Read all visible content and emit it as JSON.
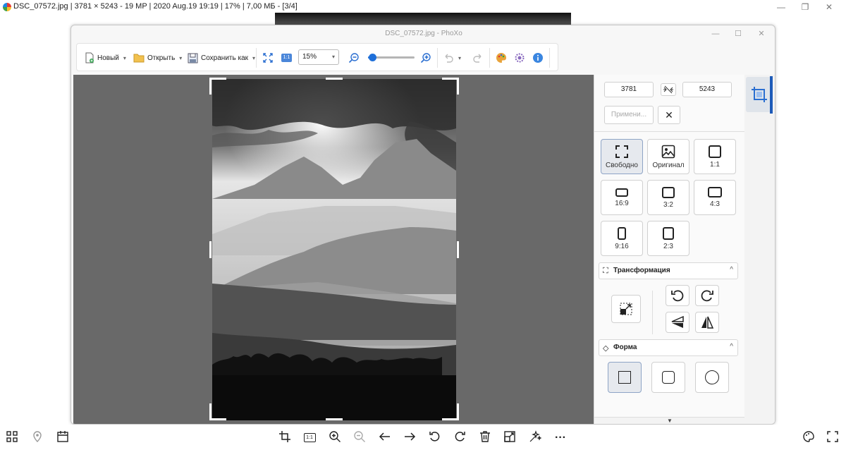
{
  "viewer": {
    "title": "DSC_07572.jpg | 3781 × 5243 - 19 MP | 2020 Aug.19 19:19 | 17% | 7,00 МБ - [3/4]"
  },
  "window": {
    "title": "DSC_07572.jpg - PhoXo"
  },
  "toolbar": {
    "new_label": "Новый",
    "open_label": "Открыть",
    "save_as_label": "Сохранить как",
    "actual_size_label": "1:1",
    "zoom_value": "15%",
    "zoom_slider_fraction": 0.05
  },
  "crop_panel": {
    "width_value": "3781",
    "height_value": "5243",
    "apply_label": "Примени...",
    "ratios": [
      {
        "label": "Свободно",
        "icon": "free-crop-icon",
        "selected": true
      },
      {
        "label": "Оригинал",
        "icon": "image-icon",
        "selected": false
      },
      {
        "label": "1:1",
        "icon": "ratio-1-1-icon",
        "selected": false
      },
      {
        "label": "16:9",
        "icon": "ratio-16-9-icon",
        "selected": false
      },
      {
        "label": "3:2",
        "icon": "ratio-3-2-icon",
        "selected": false
      },
      {
        "label": "4:3",
        "icon": "ratio-4-3-icon",
        "selected": false
      },
      {
        "label": "9:16",
        "icon": "ratio-9-16-icon",
        "selected": false
      },
      {
        "label": "2:3",
        "icon": "ratio-2-3-icon",
        "selected": false
      }
    ],
    "transform_section": "Трансформация",
    "shape_section": "Форма"
  },
  "bottom_toolbar": {
    "ratio_label": "1:1",
    "more_label": "···"
  },
  "colors": {
    "accent": "#1e6fd9",
    "canvas_bg": "#696969"
  }
}
